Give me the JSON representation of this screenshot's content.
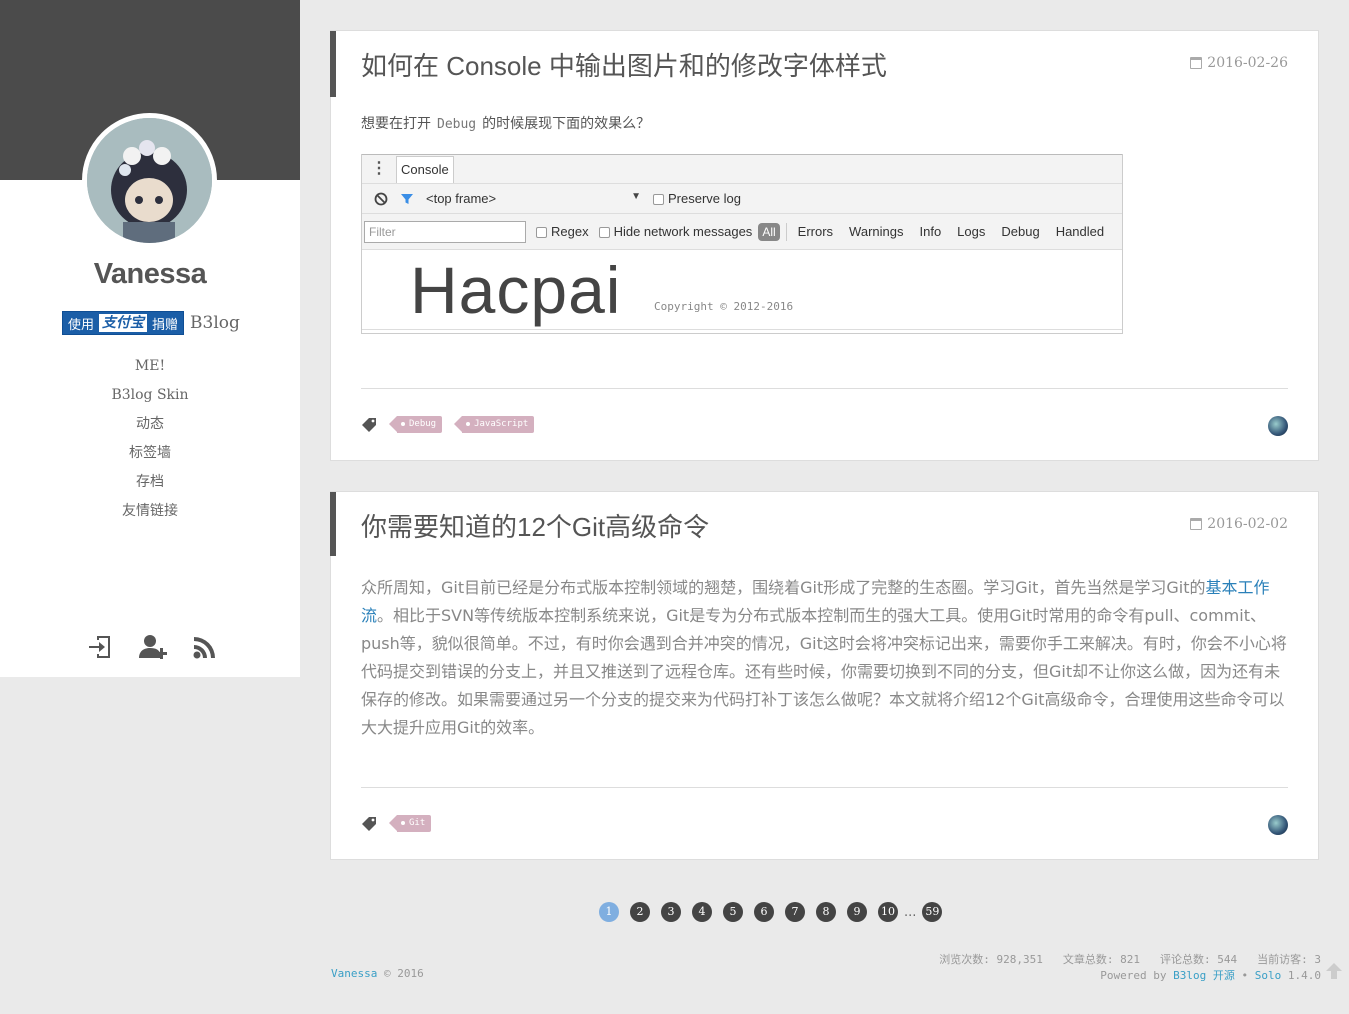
{
  "sidebar": {
    "blog_name": "Vanessa",
    "donate": {
      "pre": "使用",
      "logo": "支付宝",
      "post": "捐赠",
      "text": "B3log"
    },
    "nav": [
      {
        "label": "ME!"
      },
      {
        "label": "B3log Skin"
      },
      {
        "label": "动态"
      },
      {
        "label": "标签墙"
      },
      {
        "label": "存档"
      },
      {
        "label": "友情链接"
      }
    ],
    "icons": [
      "login-icon",
      "register-icon",
      "rss-icon"
    ]
  },
  "articles": [
    {
      "title": "如何在 Console 中输出图片和的修改字体样式",
      "date": "2016-02-26",
      "abstract_pre": "想要在打开",
      "abstract_code": "Debug",
      "abstract_post": "的时候展现下面的效果么？",
      "console": {
        "tab": "Console",
        "frame": "<top frame>",
        "frame_arrow": "▼",
        "preserve": "Preserve log",
        "filter_placeholder": "Filter",
        "regex": "Regex",
        "hide_network": "Hide network messages",
        "all": "All",
        "levels": [
          "Errors",
          "Warnings",
          "Info",
          "Logs",
          "Debug",
          "Handled"
        ],
        "output_big": "Hacpai",
        "output_copyright": "Copyright © 2012-2016"
      },
      "tags": [
        "Debug",
        "JavaScript"
      ]
    },
    {
      "title": "你需要知道的12个Git高级命令",
      "date": "2016-02-02",
      "abstract_pre": "众所周知，Git目前已经是分布式版本控制领域的翘楚，围绕着Git形成了完整的生态圈。学习Git，首先当然是学习Git的",
      "abstract_link": "基本工作流",
      "abstract_post": "。相比于SVN等传统版本控制系统来说，Git是专为分布式版本控制而生的强大工具。使用Git时常用的命令有pull、commit、push等，貌似很简单。不过，有时你会遇到合并冲突的情况，Git这时会将冲突标记出来，需要你手工来解决。有时，你会不小心将代码提交到错误的分支上，并且又推送到了远程仓库。还有些时候，你需要切换到不同的分支，但Git却不让你这么做，因为还有未保存的修改。如果需要通过另一个分支的提交来为代码打补丁该怎么做呢？本文就将介绍12个Git高级命令，合理使用这些命令可以大大提升应用Git的效率。",
      "tags": [
        "Git"
      ]
    }
  ],
  "pagination": {
    "pages": [
      "1",
      "2",
      "3",
      "4",
      "5",
      "6",
      "7",
      "8",
      "9",
      "10"
    ],
    "current": "1",
    "ellipsis": "...",
    "last": "59"
  },
  "footer": {
    "author": "Vanessa",
    "copy": "© 2016",
    "stats": [
      {
        "label": "浏览次数:",
        "value": "928,351"
      },
      {
        "label": "文章总数:",
        "value": "821"
      },
      {
        "label": "评论总数:",
        "value": "544"
      },
      {
        "label": "当前访客:",
        "value": "3"
      }
    ],
    "powered_by": "Powered by",
    "b3log": "B3log",
    "opensource": "开源",
    "bullet": "•",
    "solo": "Solo",
    "version": "1.4.0"
  },
  "colors": {
    "sidebar_top": "#4b4b4b",
    "accent_link": "#3a9fc6",
    "tag_bg": "#d4b0bf",
    "page_current": "#7faee0",
    "page_default": "#444444"
  }
}
